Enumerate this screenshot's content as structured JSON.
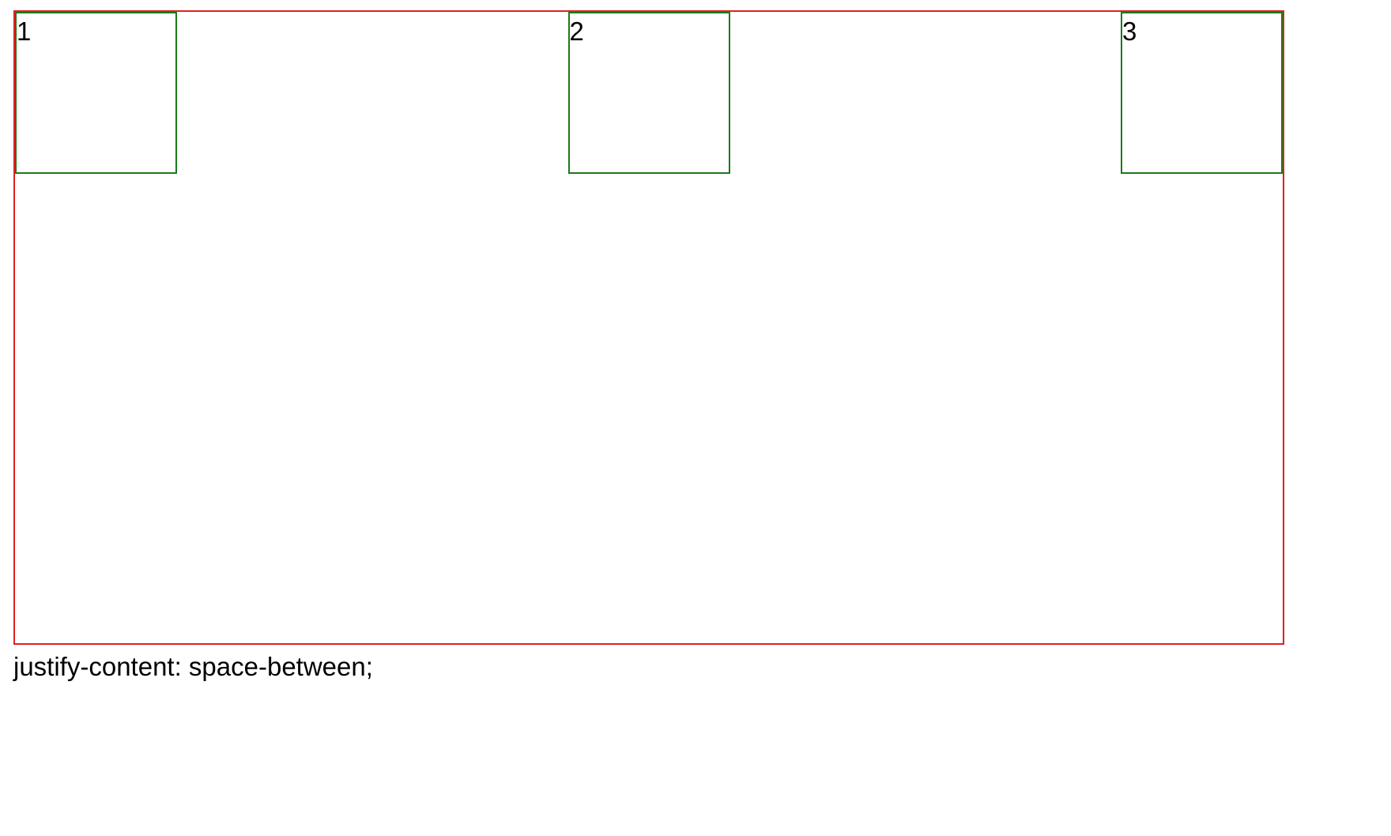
{
  "demo": {
    "items": [
      {
        "label": "1"
      },
      {
        "label": "2"
      },
      {
        "label": "3"
      }
    ],
    "caption": "justify-content: space-between;"
  },
  "colors": {
    "container_border": "#e02020",
    "item_border": "#1a7a1a",
    "background": "#ffffff",
    "text": "#000000"
  }
}
